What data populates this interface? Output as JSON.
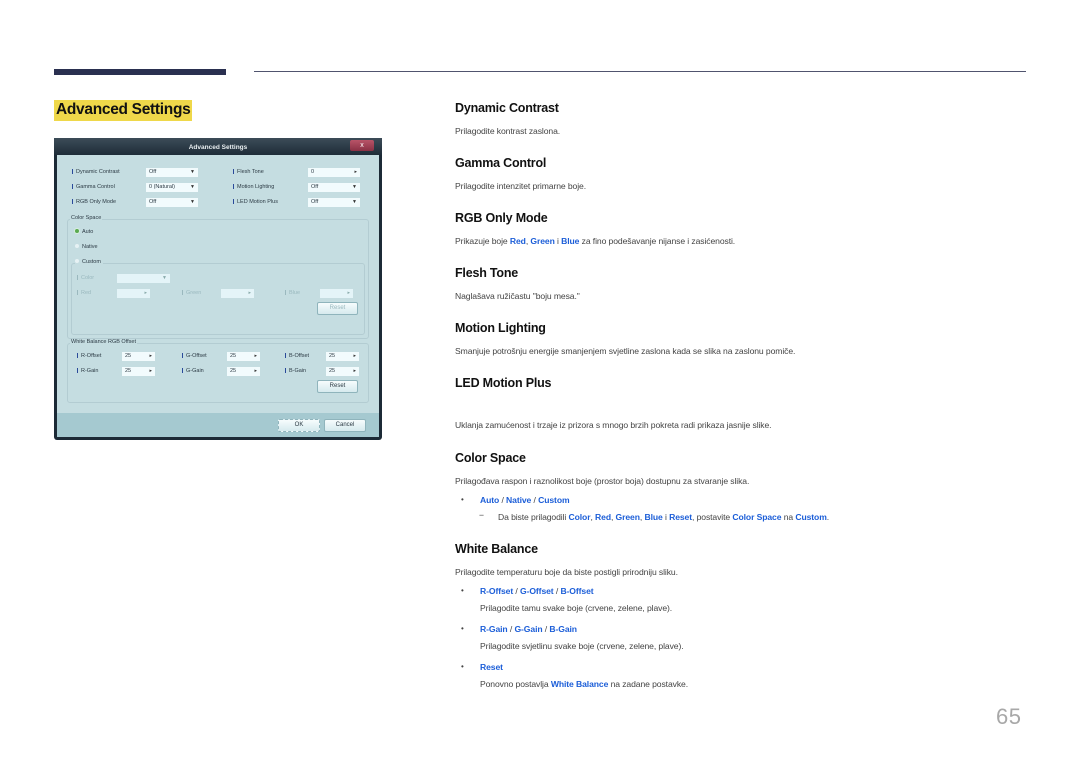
{
  "page": {
    "title": "Advanced Settings",
    "page_number": "65"
  },
  "dialog": {
    "title": "Advanced Settings",
    "close_label": "x",
    "settings_left": [
      {
        "label": "Dynamic Contrast",
        "value": "Off",
        "control": "dropdown"
      },
      {
        "label": "Gamma Control",
        "value": "0 (Natural)",
        "control": "dropdown"
      },
      {
        "label": "RGB Only Mode",
        "value": "Off",
        "control": "dropdown"
      }
    ],
    "settings_right": [
      {
        "label": "Flesh Tone",
        "value": "0",
        "control": "stepper"
      },
      {
        "label": "Motion Lighting",
        "value": "Off",
        "control": "dropdown"
      },
      {
        "label": "LED Motion Plus",
        "value": "Off",
        "control": "dropdown"
      }
    ],
    "color_space": {
      "group_title": "Color Space",
      "options": [
        "Auto",
        "Native",
        "Custom"
      ],
      "selected": "Auto",
      "custom": {
        "color_label": "Color",
        "color_value": "",
        "red_label": "Red",
        "green_label": "Green",
        "blue_label": "Blue",
        "reset_label": "Reset"
      }
    },
    "white_balance": {
      "group_title": "White Balance RGB Offset",
      "fields": [
        {
          "label": "R-Offset",
          "value": "25"
        },
        {
          "label": "G-Offset",
          "value": "25"
        },
        {
          "label": "B-Offset",
          "value": "25"
        },
        {
          "label": "R-Gain",
          "value": "25"
        },
        {
          "label": "G-Gain",
          "value": "25"
        },
        {
          "label": "B-Gain",
          "value": "25"
        }
      ],
      "reset_label": "Reset"
    },
    "ok_label": "OK",
    "cancel_label": "Cancel"
  },
  "sections": {
    "dynamic_contrast": {
      "title": "Dynamic Contrast",
      "text": "Prilagodite kontrast zaslona."
    },
    "gamma_control": {
      "title": "Gamma Control",
      "text": "Prilagodite intenzitet primarne boje."
    },
    "rgb_only_mode": {
      "title": "RGB Only Mode",
      "text_pre": "Prikazuje boje ",
      "red": "Red",
      "comma": ", ",
      "green": "Green",
      "and": " i ",
      "blue": "Blue",
      "text_post": " za fino podešavanje nijanse i zasićenosti."
    },
    "flesh_tone": {
      "title": "Flesh Tone",
      "text": "Naglašava ružičastu \"boju mesa.\""
    },
    "motion_lighting": {
      "title": "Motion Lighting",
      "text": "Smanjuje potrošnju energije smanjenjem svjetline zaslona kada se slika na zaslonu pomiče."
    },
    "led_motion_plus": {
      "title": "LED Motion Plus",
      "text": "Uklanja zamućenost i trzaje iz prizora s mnogo brzih pokreta radi prikaza jasnije slike."
    },
    "color_space": {
      "title": "Color Space",
      "text": "Prilagođava raspon i raznolikost boje (prostor boja) dostupnu za stvaranje slika.",
      "bullet_options": [
        "Auto",
        "Native",
        "Custom"
      ],
      "separator": " / ",
      "note_pre": "Da biste prilagodili ",
      "note_terms": [
        "Color",
        "Red",
        "Green",
        "Blue",
        "Reset"
      ],
      "note_mid": ", postavite ",
      "note_setting": "Color Space",
      "note_na": " na ",
      "note_value": "Custom",
      "note_end": "."
    },
    "white_balance": {
      "title": "White Balance",
      "text": "Prilagodite temperaturu boje da biste postigli prirodniju sliku.",
      "items": [
        {
          "terms": [
            "R-Offset",
            "G-Offset",
            "B-Offset"
          ],
          "desc": "Prilagodite tamu svake boje (crvene, zelene, plave)."
        },
        {
          "terms": [
            "R-Gain",
            "G-Gain",
            "B-Gain"
          ],
          "desc": "Prilagodite svjetlinu svake boje (crvene, zelene, plave)."
        },
        {
          "terms": [
            "Reset"
          ],
          "desc_pre": "Ponovno postavlja ",
          "desc_term": "White Balance",
          "desc_post": " na zadane postavke."
        }
      ]
    }
  }
}
